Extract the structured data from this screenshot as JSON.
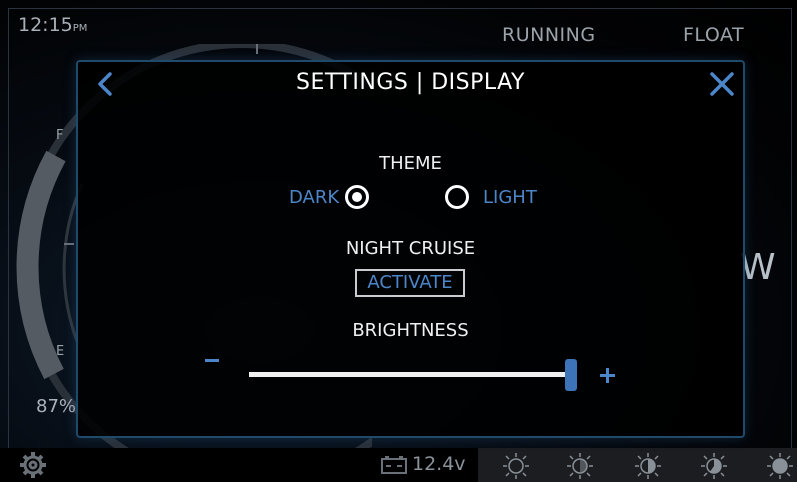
{
  "status": {
    "time": "12:15",
    "time_suffix": "PM",
    "running": "RUNNING",
    "float": "FLOAT",
    "percent": "87%",
    "voltage": "12.4v",
    "gauge_top": "F",
    "gauge_bottom": "E",
    "compass": "W"
  },
  "dialog": {
    "title": "SETTINGS | DISPLAY",
    "theme": {
      "label": "THEME",
      "dark": "DARK",
      "light": "LIGHT",
      "selected": "DARK"
    },
    "night_cruise": {
      "label": "NIGHT CRUISE",
      "button": "ACTIVATE"
    },
    "brightness": {
      "label": "BRIGHTNESS",
      "level": 1.0
    }
  },
  "colors": {
    "accent": "#4d86c8",
    "dialog_border": "#1f4a6a",
    "background": "#000000"
  },
  "icons": [
    "back-chevron-icon",
    "close-icon",
    "gear-icon",
    "battery-icon",
    "brightness-icon"
  ]
}
